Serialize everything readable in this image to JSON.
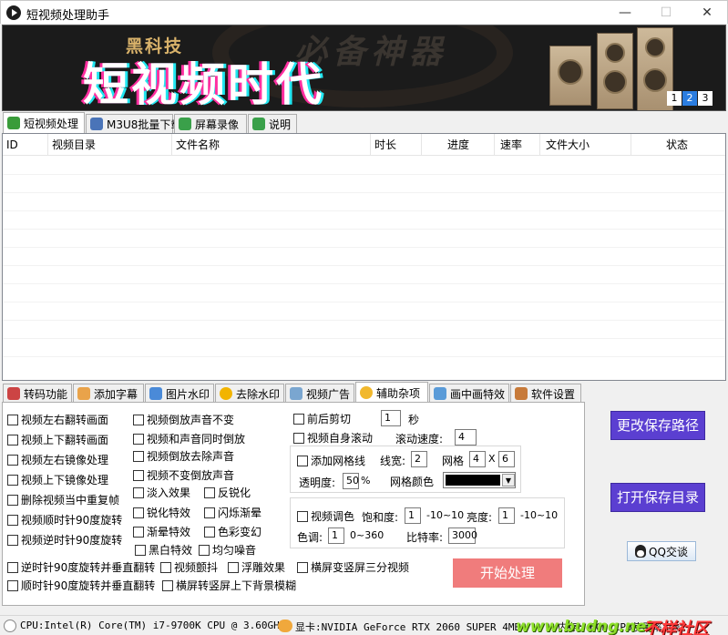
{
  "window": {
    "title": "短视频处理助手",
    "minimize": "—",
    "maximize": "☐",
    "close": "✕"
  },
  "banner": {
    "small_text": "黑科技",
    "big_text": "短视频时代",
    "watermark": "必备神器",
    "pages": [
      "1",
      "2",
      "3"
    ],
    "active_page": 1
  },
  "top_tabs": [
    {
      "label": "短视频处理",
      "icon": "video-icon",
      "active": true
    },
    {
      "label": "M3U8批量下载",
      "icon": "grid-icon",
      "active": false
    },
    {
      "label": "屏幕录像",
      "icon": "screen-icon",
      "active": false
    },
    {
      "label": "说明",
      "icon": "info-icon",
      "active": false
    }
  ],
  "table": {
    "columns": [
      "ID",
      "视频目录",
      "文件名称",
      "时长",
      "进度",
      "速率",
      "文件大小",
      "状态"
    ],
    "rows": []
  },
  "feature_tabs": [
    {
      "label": "转码功能",
      "icon": "transcode-icon",
      "active": false
    },
    {
      "label": "添加字幕",
      "icon": "subtitle-icon",
      "active": false
    },
    {
      "label": "图片水印",
      "icon": "image-icon",
      "active": false
    },
    {
      "label": "去除水印",
      "icon": "sun-icon",
      "active": false
    },
    {
      "label": "视频广告",
      "icon": "ad-icon",
      "active": false
    },
    {
      "label": "辅助杂项",
      "icon": "gear-icon",
      "active": true
    },
    {
      "label": "画中画特效",
      "icon": "pip-icon",
      "active": false
    },
    {
      "label": "软件设置",
      "icon": "settings-icon",
      "active": false
    }
  ],
  "options": {
    "col1": [
      "视频左右翻转画面",
      "视频上下翻转画面",
      "视频左右镜像处理",
      "视频上下镜像处理",
      "删除视频当中重复帧",
      "视频顺时针90度旋转",
      "视频逆时针90度旋转"
    ],
    "col2": [
      "视频倒放声音不变",
      "视频和声音同时倒放",
      "视频倒放去除声音",
      "视频不变倒放声音"
    ],
    "effects": [
      "淡入效果",
      "反锐化",
      "锐化特效",
      "闪烁渐晕",
      "渐晕特效",
      "色彩变幻",
      "黑白特效",
      "均匀噪音"
    ],
    "bottom": [
      "逆时针90度旋转并垂直翻转",
      "视频颤抖",
      "浮雕效果",
      "横屏变竖屏三分视频",
      "顺时针90度旋转并垂直翻转",
      "横屏转竖屏上下背景模糊"
    ]
  },
  "trim": {
    "label": "前后剪切",
    "value": "1",
    "unit": "秒"
  },
  "scroll": {
    "label": "视频自身滚动",
    "speed_label": "滚动速度:",
    "speed": "4"
  },
  "grid": {
    "label": "添加网格线",
    "line_width_label": "线宽:",
    "line_width": "2",
    "grid_label": "网格",
    "grid_x": "4",
    "x": "X",
    "grid_y": "6",
    "opacity_label": "透明度:",
    "opacity": "50",
    "opacity_unit": "%",
    "color_label": "网格颜色",
    "color": "#000000"
  },
  "tone": {
    "label": "视频调色",
    "saturation_label": "饱和度:",
    "saturation": "1",
    "saturation_range": "-10~10",
    "brightness_label": "亮度:",
    "brightness": "1",
    "brightness_range": "-10~10",
    "hue_label": "色调:",
    "hue": "1",
    "hue_range": "0~360",
    "bitrate_label": "比特率:",
    "bitrate": "3000"
  },
  "buttons": {
    "change_path": "更改保存路径",
    "open_dir": "打开保存目录",
    "qq": "QQ交谈",
    "start": "开始处理"
  },
  "status": {
    "cpu": "CPU:Intel(R) Core(TM) i7-9700K CPU @ 3.60GHz",
    "gpu": "显卡:NVIDIA GeForce RTX 2060 SUPER  4MB",
    "mem": "内存: 6GB  CPU使用率:4%",
    "watermark": "www.budng.net",
    "watermark2": "不样社区"
  }
}
